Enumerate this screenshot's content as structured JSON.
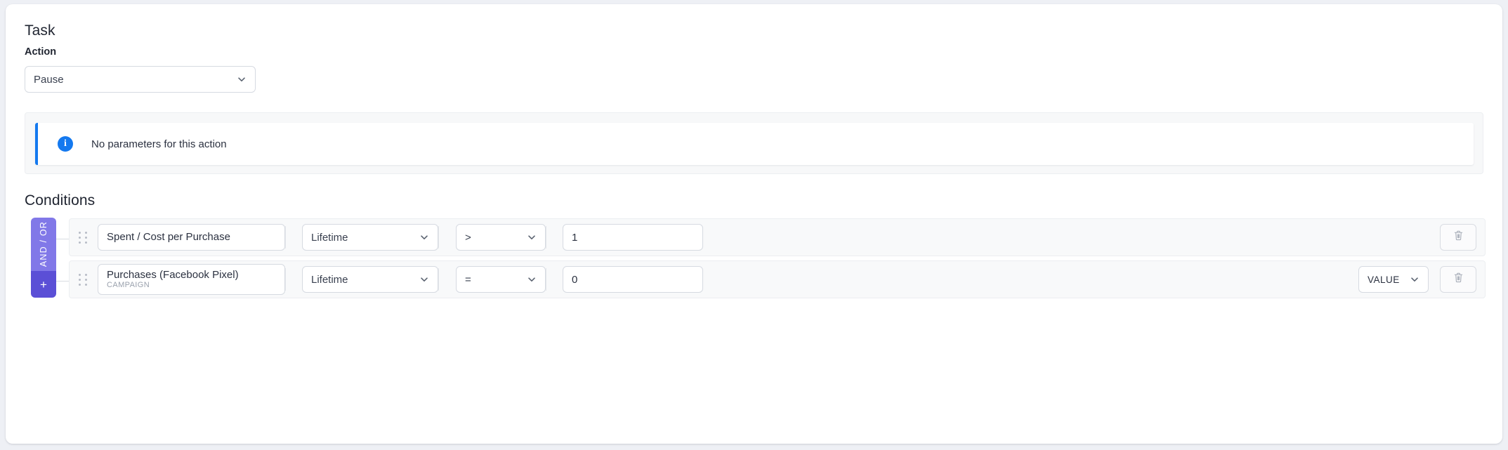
{
  "task": {
    "heading": "Task",
    "action_label": "Action",
    "action_value": "Pause"
  },
  "parameters": {
    "info_icon": "info-icon",
    "message": "No parameters for this action",
    "accent_color": "#1479ef"
  },
  "conditions": {
    "heading": "Conditions",
    "logic": {
      "operator_label": "AND / OR",
      "add_label": "+",
      "badge_color": "#8178e8",
      "add_color": "#5b4fd6"
    },
    "rows": [
      {
        "metric": "Spent / Cost per Purchase",
        "scope": "",
        "window": "Lifetime",
        "operator": ">",
        "value": "1",
        "value_type": "",
        "delete_icon": "trash-icon"
      },
      {
        "metric": "Purchases (Facebook Pixel)",
        "scope": "CAMPAIGN",
        "window": "Lifetime",
        "operator": "=",
        "value": "0",
        "value_type": "VALUE",
        "delete_icon": "trash-icon"
      }
    ]
  }
}
